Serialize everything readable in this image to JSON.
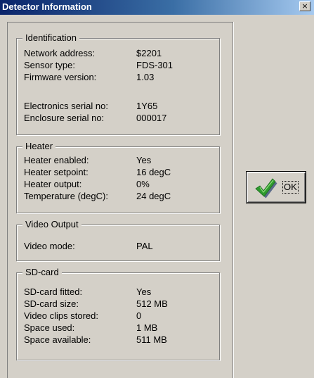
{
  "window": {
    "title": "Detector Information",
    "close_glyph": "×"
  },
  "groups": {
    "identification": {
      "title": "Identification",
      "rows": [
        {
          "label": "Network address:",
          "value": "$2201"
        },
        {
          "label": "Sensor type:",
          "value": "FDS-301"
        },
        {
          "label": "Firmware version:",
          "value": "1.03"
        },
        {
          "label": "Electronics serial no:",
          "value": "1Y65"
        },
        {
          "label": "Enclosure serial no:",
          "value": "000017"
        }
      ]
    },
    "heater": {
      "title": "Heater",
      "rows": [
        {
          "label": "Heater enabled:",
          "value": "Yes"
        },
        {
          "label": "Heater setpoint:",
          "value": "16 degC"
        },
        {
          "label": "Heater output:",
          "value": "0%"
        },
        {
          "label": "Temperature (degC):",
          "value": "24 degC"
        }
      ]
    },
    "video_output": {
      "title": "Video Output",
      "rows": [
        {
          "label": "Video mode:",
          "value": "PAL"
        }
      ]
    },
    "sd_card": {
      "title": "SD-card",
      "rows": [
        {
          "label": "SD-card fitted:",
          "value": "Yes"
        },
        {
          "label": "SD-card size:",
          "value": "512 MB"
        },
        {
          "label": "Video clips stored:",
          "value": "0"
        },
        {
          "label": "Space used:",
          "value": "1 MB"
        },
        {
          "label": "Space available:",
          "value": "511 MB"
        }
      ]
    }
  },
  "ok_button": {
    "label": "OK",
    "icon": "checkmark-icon",
    "icon_colors": {
      "fill": "#2e9a2e",
      "shadow": "#5a6a8a"
    }
  },
  "colors": {
    "titlebar_start": "#0a246a",
    "titlebar_end": "#a6caf0",
    "face": "#d4d0c8"
  }
}
